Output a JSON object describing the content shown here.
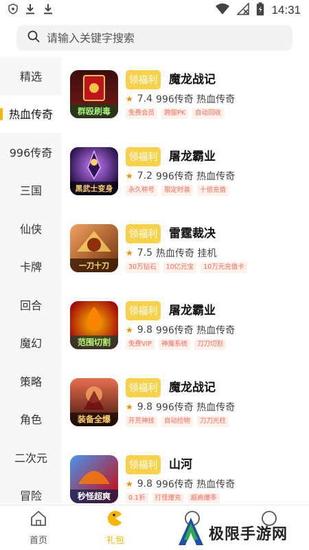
{
  "statusbar": {
    "time": "14:31",
    "icons": [
      "shield-icon",
      "download-icon",
      "download-icon",
      "wifi-icon",
      "no-signal-icon",
      "battery-icon"
    ]
  },
  "search": {
    "placeholder": "请输入关键字搜索"
  },
  "sidebar": {
    "items": [
      {
        "label": "精选"
      },
      {
        "label": "热血传奇",
        "active": true
      },
      {
        "label": "996传奇"
      },
      {
        "label": "三国"
      },
      {
        "label": "仙侠"
      },
      {
        "label": "卡牌"
      },
      {
        "label": "回合"
      },
      {
        "label": "魔幻"
      },
      {
        "label": "策略"
      },
      {
        "label": "角色"
      },
      {
        "label": "二次元"
      },
      {
        "label": "冒险"
      }
    ]
  },
  "gift_label": "领福利",
  "games": [
    {
      "name": "魔龙战记",
      "rating": "7.4",
      "tags_text": "996传奇 热血传奇",
      "icon_text": "群殴刷毒",
      "features": [
        "免费会员",
        "跨服PK",
        "自动回收"
      ]
    },
    {
      "name": "屠龙霸业",
      "rating": "7.2",
      "tags_text": "996传奇 热血传奇",
      "icon_text": "黑武士变身",
      "features": [
        "永久称号",
        "限定时装",
        "十倍充值"
      ]
    },
    {
      "name": "雷霆裁决",
      "rating": "7.5",
      "tags_text": "热血传奇 挂机",
      "icon_text": "一刀十刀",
      "features": [
        "30万钻石",
        "10亿元宝",
        "10万元充值卡"
      ]
    },
    {
      "name": "屠龙霸业",
      "rating": "9.8",
      "tags_text": "996传奇 热血传奇",
      "icon_text": "范围切割",
      "features": [
        "免费VIP",
        "神魔系统",
        "刀刀切割"
      ]
    },
    {
      "name": "魔龙战记",
      "rating": "9.8",
      "tags_text": "996传奇 热血传奇",
      "icon_text": "装备全爆",
      "features": [
        "开荒神技",
        "自动捡物",
        "刀刀光柱"
      ]
    },
    {
      "name": "山河",
      "rating": "9.8",
      "tags_text": "996传奇 热血传奇",
      "icon_text": "秒怪超爽",
      "features": [
        "0.1折",
        "打怪爆充",
        "超高爆率"
      ]
    }
  ],
  "tabbar": {
    "tabs": [
      {
        "label": "首页",
        "icon": "home-icon"
      },
      {
        "label": "礼包",
        "icon": "gift-pac-icon",
        "active": true
      },
      {
        "label": "",
        "icon": "circle-icon"
      },
      {
        "label": "",
        "icon": "circle-icon"
      }
    ]
  },
  "watermark": {
    "text": "极限手游网"
  },
  "colors": {
    "accent": "#f7b500",
    "gift_button": "#f8d14a",
    "star": "#ff8a00",
    "tag_text": "#ff6a5c",
    "tag_bg": "#fff0ea"
  }
}
